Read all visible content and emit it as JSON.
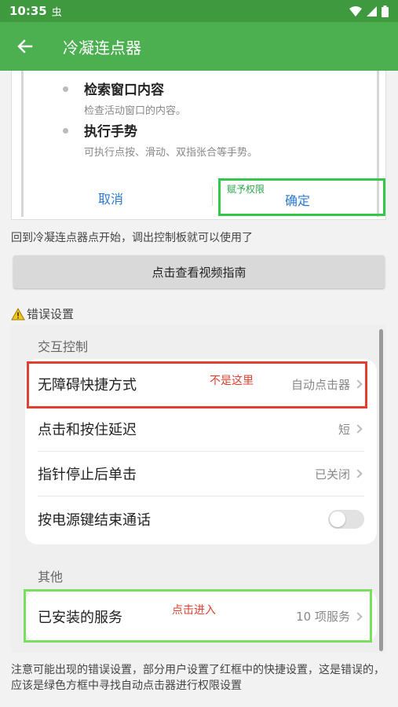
{
  "status_bar": {
    "time": "10:35",
    "notification_glyph": "虫",
    "icons": [
      "wifi-icon",
      "signal-icon",
      "battery-icon"
    ]
  },
  "app_bar": {
    "title": "冷凝连点器",
    "back_icon": "back-arrow-icon",
    "color": "#4caf50"
  },
  "permission_dialog": {
    "items": [
      {
        "title": "检索窗口内容",
        "desc": "检查活动窗口的内容。"
      },
      {
        "title": "执行手势",
        "desc": "可执行点按、滑动、双指张合等手势。"
      }
    ],
    "cancel_label": "取消",
    "confirm_label": "确定",
    "confirm_note": "赋予权限"
  },
  "tip_top": "回到冷凝连点器点开始，调出控制板就可以使用了",
  "guide_button": "点击查看视频指南",
  "warning": {
    "icon": "warning-icon",
    "title": "错误设置"
  },
  "settings_screenshot": {
    "section1_title": "交互控制",
    "rows": [
      {
        "label": "无障碍快捷方式",
        "value": "自动点击器"
      },
      {
        "label": "点击和按住延迟",
        "value": "短"
      },
      {
        "label": "指针停止后单击",
        "value": "已关闭"
      },
      {
        "label": "按电源键结束通话",
        "value": ""
      }
    ],
    "section2_title": "其他",
    "services_row": {
      "label": "已安装的服务",
      "value": "10 项服务"
    },
    "red_note": "不是这里",
    "green_note": "点击进入"
  },
  "tip_bottom": "注意可能出现的错误设置，部分用户设置了红框中的快捷设置，这是错误的，应该是绿色方框中寻找自动点击器进行权限设置"
}
